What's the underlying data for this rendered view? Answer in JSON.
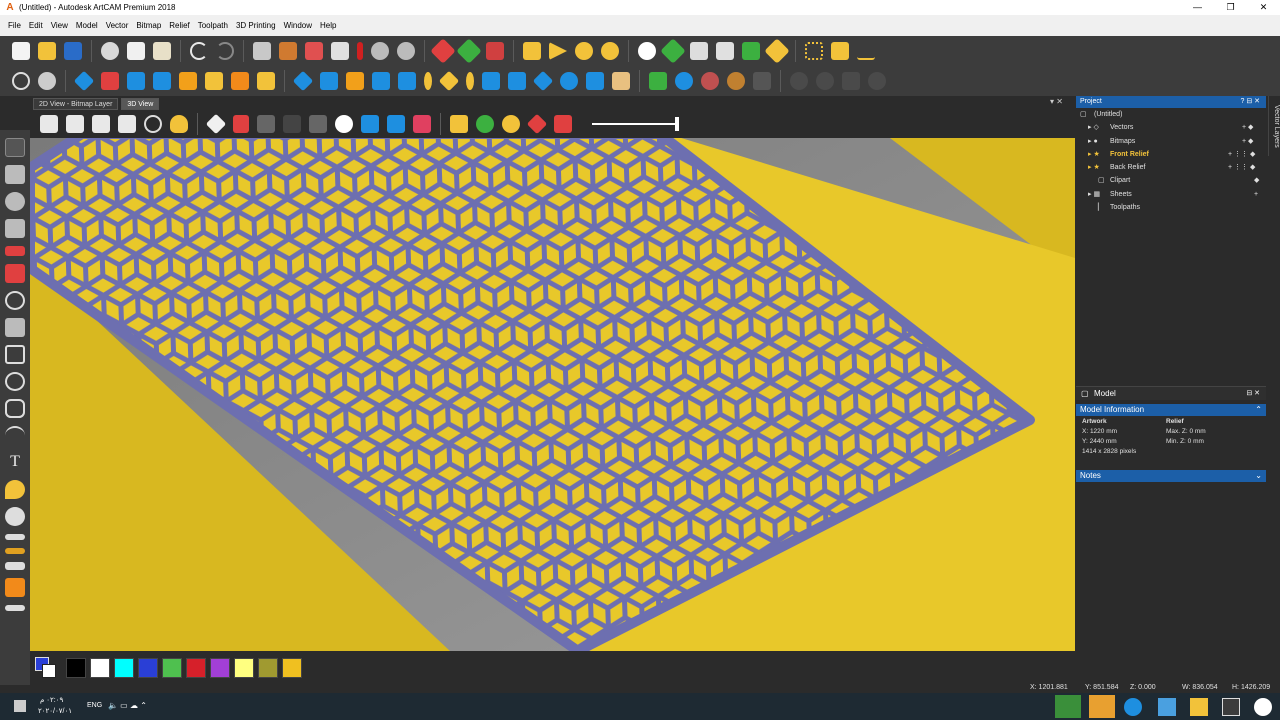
{
  "window": {
    "title": "(Untitled) - Autodesk ArtCAM Premium 2018",
    "controls": [
      "—",
      "❐",
      "✕"
    ]
  },
  "menu": [
    "File",
    "Edit",
    "View",
    "Model",
    "Vector",
    "Bitmap",
    "Relief",
    "Toolpath",
    "3D Printing",
    "Window",
    "Help"
  ],
  "view_tabs": [
    "2D View - Bitmap Layer",
    "3D View"
  ],
  "project": {
    "header": "Project",
    "vector_layers_label": "Vector Layers",
    "items": [
      "(Untitled)",
      "Vectors",
      "Bitmaps",
      "Front Relief",
      "Back Relief",
      "Clipart",
      "Sheets",
      "Toolpaths"
    ]
  },
  "model": {
    "header": "Model",
    "info_header": "Model Information",
    "artwork_label": "Artwork",
    "relief_label": "Relief",
    "x_size": "X: 1220 mm",
    "y_size": "Y: 2440 mm",
    "pixels": "1414 x 2828 pixels",
    "max_z": "Max. Z: 0 mm",
    "min_z": "Min. Z: 0 mm",
    "notes": "Notes"
  },
  "status": {
    "x": "X: 1201.881",
    "y": "Y: 851.584",
    "z": "Z: 0.000",
    "w": "W: 836.054",
    "h": "H: 1426.209"
  },
  "taskbar": {
    "lang": "ENG",
    "time": "٠٢:٠٩ م",
    "date": "٢٠٢٠/٠٧/٠١"
  },
  "palette": [
    "#000000",
    "#ffffff",
    "#00ffff",
    "#2a3fd6",
    "#4fc04f",
    "#d6202a",
    "#a23fd6",
    "#ffff80",
    "#a09a30",
    "#f0c020"
  ],
  "colors": {
    "plate": "#e8c82a",
    "lattice": "#6d6fb0",
    "selection": "#1c5fa8",
    "background": "#8a8a8a"
  }
}
